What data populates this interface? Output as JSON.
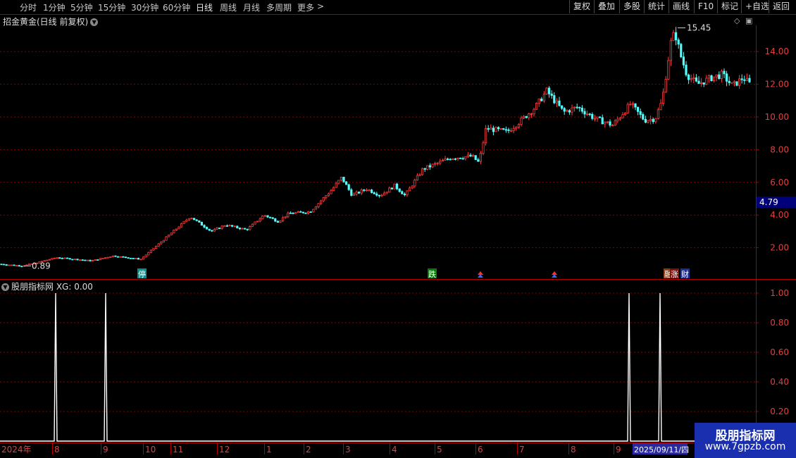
{
  "toolbar": {
    "periods": [
      "分时",
      "1分钟",
      "5分钟",
      "15分钟",
      "30分钟",
      "60分钟",
      "日线",
      "周线",
      "月线",
      "多周期",
      "更多"
    ],
    "active_period": "日线",
    "more_glyph": ">",
    "right_buttons": [
      "复权",
      "叠加",
      "多股",
      "统计",
      "画线",
      "F10",
      "标记",
      "+自选",
      "返回"
    ]
  },
  "chart_title": "招金黄金(日线 前复权)",
  "indicator_title": "股朋指标网 XG: 0.00",
  "watermark": {
    "line1": "股朋指标网",
    "line2": "www.7gpzb.com"
  },
  "colors": {
    "up": "#ff3c3c",
    "down": "#54fcfc",
    "grid": "#8b0000",
    "axis": "#b00000",
    "price_label_bg": "#00007a"
  },
  "chart_data": [
    {
      "type": "candlestick",
      "title": "招金黄金(日线 前复权)",
      "ylim": [
        0,
        16
      ],
      "y_ticks": [
        "2.00",
        "4.00",
        "6.00",
        "8.00",
        "10.00",
        "12.00",
        "14.00"
      ],
      "current_price_label": "4.79",
      "annotations": {
        "high": "15.45",
        "low": "0.89"
      },
      "event_markers": [
        "停",
        "跌",
        "融",
        "涨",
        "财"
      ],
      "approx_close_path": [
        {
          "x": 0,
          "y": 1.0
        },
        {
          "x": 30,
          "y": 0.89
        },
        {
          "x": 45,
          "y": 1.0
        },
        {
          "x": 80,
          "y": 1.4
        },
        {
          "x": 130,
          "y": 1.2
        },
        {
          "x": 160,
          "y": 1.5
        },
        {
          "x": 200,
          "y": 1.3
        },
        {
          "x": 230,
          "y": 2.4
        },
        {
          "x": 270,
          "y": 3.9
        },
        {
          "x": 300,
          "y": 3.0
        },
        {
          "x": 320,
          "y": 3.4
        },
        {
          "x": 350,
          "y": 3.1
        },
        {
          "x": 375,
          "y": 4.0
        },
        {
          "x": 395,
          "y": 3.6
        },
        {
          "x": 410,
          "y": 4.1
        },
        {
          "x": 440,
          "y": 4.2
        },
        {
          "x": 470,
          "y": 5.5
        },
        {
          "x": 485,
          "y": 6.3
        },
        {
          "x": 500,
          "y": 5.2
        },
        {
          "x": 520,
          "y": 5.6
        },
        {
          "x": 540,
          "y": 5.2
        },
        {
          "x": 560,
          "y": 5.8
        },
        {
          "x": 575,
          "y": 5.2
        },
        {
          "x": 600,
          "y": 6.8
        },
        {
          "x": 640,
          "y": 7.5
        },
        {
          "x": 670,
          "y": 7.6
        },
        {
          "x": 680,
          "y": 7.2
        },
        {
          "x": 690,
          "y": 9.3
        },
        {
          "x": 720,
          "y": 9.1
        },
        {
          "x": 740,
          "y": 9.8
        },
        {
          "x": 760,
          "y": 10.6
        },
        {
          "x": 776,
          "y": 11.6
        },
        {
          "x": 800,
          "y": 10.3
        },
        {
          "x": 820,
          "y": 10.6
        },
        {
          "x": 845,
          "y": 9.9
        },
        {
          "x": 870,
          "y": 9.5
        },
        {
          "x": 895,
          "y": 10.8
        },
        {
          "x": 915,
          "y": 9.8
        },
        {
          "x": 930,
          "y": 9.9
        },
        {
          "x": 940,
          "y": 11.0
        },
        {
          "x": 952,
          "y": 14.5
        },
        {
          "x": 958,
          "y": 15.2
        },
        {
          "x": 966,
          "y": 13.8
        },
        {
          "x": 975,
          "y": 12.6
        },
        {
          "x": 990,
          "y": 12.0
        },
        {
          "x": 1010,
          "y": 12.4
        },
        {
          "x": 1025,
          "y": 12.6
        },
        {
          "x": 1040,
          "y": 11.9
        },
        {
          "x": 1055,
          "y": 12.4
        },
        {
          "x": 1065,
          "y": 12.0
        }
      ]
    },
    {
      "type": "line",
      "title": "股朋指标网 XG: 0.00",
      "ylim": [
        0,
        1.05
      ],
      "y_ticks": [
        "0.20",
        "0.40",
        "0.60",
        "0.80",
        "1.00"
      ],
      "x_ticks": [
        "2024年",
        "8",
        "9",
        "10",
        "11",
        "12",
        "1",
        "2",
        "3",
        "4",
        "5",
        "6",
        "7",
        "8",
        "9",
        "2025/09/11/四"
      ],
      "signals_x": [
        79,
        150,
        893,
        937
      ],
      "signal_value": 1.0
    }
  ]
}
